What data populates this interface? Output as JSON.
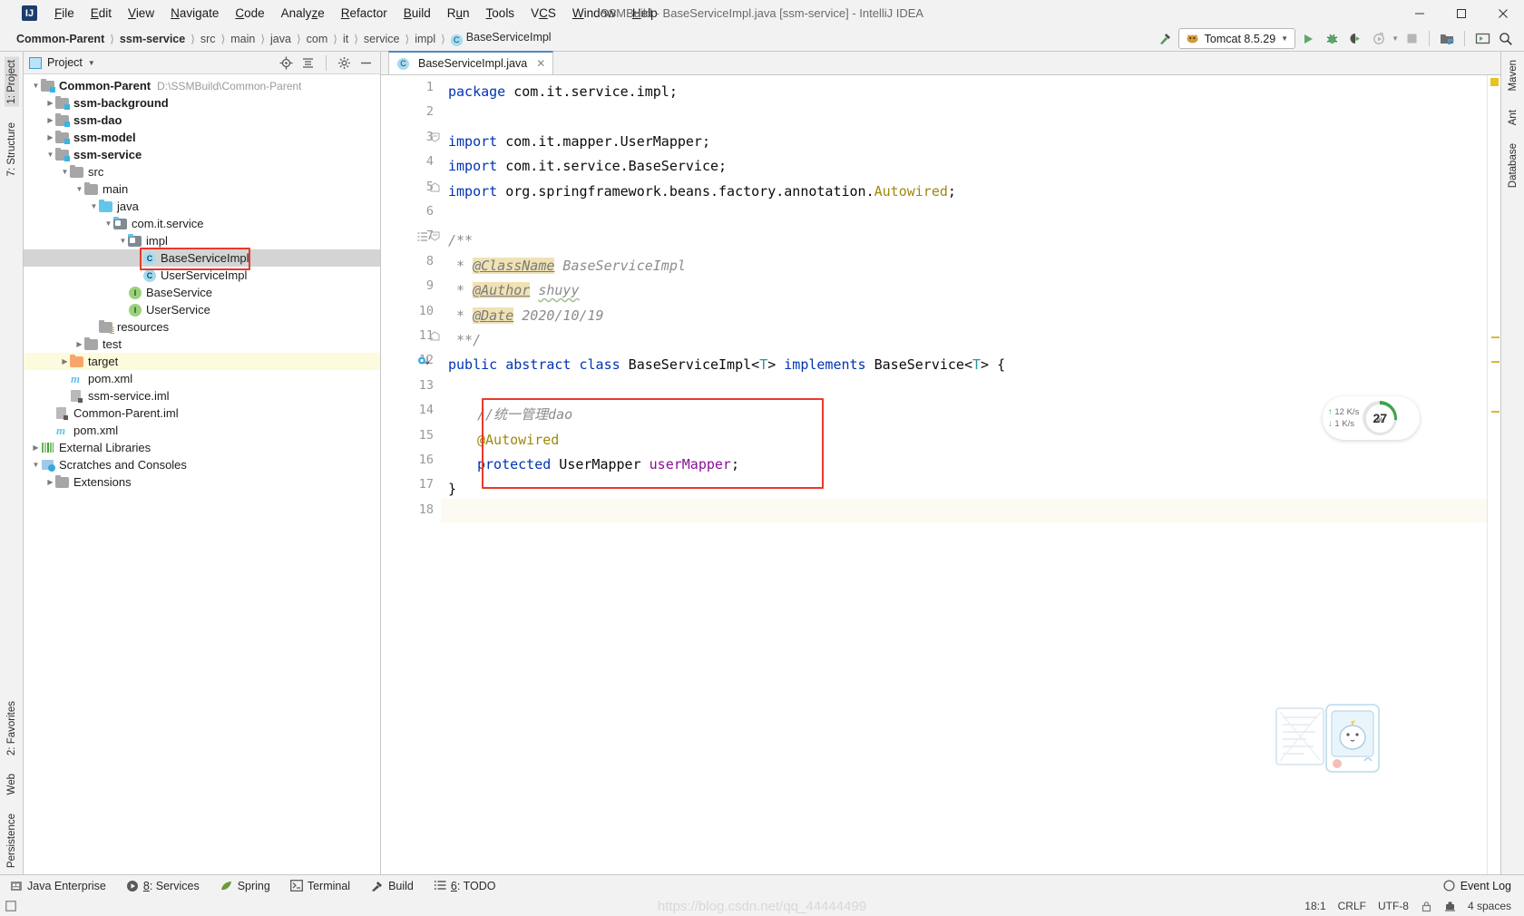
{
  "window": {
    "title": "SSMBuild - BaseServiceImpl.java [ssm-service] - IntelliJ IDEA",
    "logo": "IJ",
    "minimize": "–",
    "maximize": "☐",
    "close": "✕"
  },
  "menubar": [
    {
      "label": "File"
    },
    {
      "label": "Edit"
    },
    {
      "label": "View"
    },
    {
      "label": "Navigate"
    },
    {
      "label": "Code"
    },
    {
      "label": "Analyze"
    },
    {
      "label": "Refactor"
    },
    {
      "label": "Build"
    },
    {
      "label": "Run"
    },
    {
      "label": "Tools"
    },
    {
      "label": "VCS"
    },
    {
      "label": "Window"
    },
    {
      "label": "Help"
    }
  ],
  "breadcrumbs": [
    {
      "label": "Common-Parent",
      "bold": true
    },
    {
      "label": "ssm-service",
      "bold": true
    },
    {
      "label": "src"
    },
    {
      "label": "main"
    },
    {
      "label": "java"
    },
    {
      "label": "com"
    },
    {
      "label": "it"
    },
    {
      "label": "service"
    },
    {
      "label": "impl"
    },
    {
      "label": "BaseServiceImpl",
      "badge": "C"
    }
  ],
  "toolbar": {
    "run_config": "Tomcat 8.5.29",
    "run_button": "run-icon",
    "debug_button": "debug-icon",
    "coverage_button": "run-with-coverage-icon",
    "profiler_button": "profiler-icon",
    "stop_button": "stop-icon",
    "build_button": "make-project-icon",
    "update_button": "update-project-icon",
    "search_button": "search-everywhere-icon",
    "hammer_icon": "build-hammer-icon"
  },
  "left_rail": {
    "top": [
      {
        "label": "1: Project",
        "selected": true
      },
      {
        "label": "7: Structure",
        "selected": false
      }
    ],
    "bottom": [
      {
        "label": "2: Favorites"
      },
      {
        "label": "Web"
      },
      {
        "label": "Persistence"
      }
    ]
  },
  "right_rail": [
    {
      "label": "Maven"
    },
    {
      "label": "Ant"
    },
    {
      "label": "Database"
    }
  ],
  "project_panel": {
    "title": "Project",
    "actions": [
      "locate-icon",
      "collapse-all-icon",
      "settings-gear-icon",
      "hide-icon"
    ],
    "tree": [
      {
        "indent": 0,
        "arrow": "down",
        "icon": "module",
        "label": "Common-Parent",
        "bold": true,
        "path": "D:\\SSMBuild\\Common-Parent"
      },
      {
        "indent": 1,
        "arrow": "right",
        "icon": "module",
        "label": "ssm-background",
        "bold": true
      },
      {
        "indent": 1,
        "arrow": "right",
        "icon": "module",
        "label": "ssm-dao",
        "bold": true
      },
      {
        "indent": 1,
        "arrow": "right",
        "icon": "module",
        "label": "ssm-model",
        "bold": true
      },
      {
        "indent": 1,
        "arrow": "down",
        "icon": "module",
        "label": "ssm-service",
        "bold": true
      },
      {
        "indent": 2,
        "arrow": "down",
        "icon": "folder",
        "label": "src"
      },
      {
        "indent": 3,
        "arrow": "down",
        "icon": "folder",
        "label": "main"
      },
      {
        "indent": 4,
        "arrow": "down",
        "icon": "folder-blue",
        "label": "java"
      },
      {
        "indent": 5,
        "arrow": "down",
        "icon": "package",
        "label": "com.it.service"
      },
      {
        "indent": 6,
        "arrow": "down",
        "icon": "package",
        "label": "impl"
      },
      {
        "indent": 7,
        "arrow": "blank",
        "icon": "class",
        "label": "BaseServiceImpl",
        "selected": true,
        "boxed": true
      },
      {
        "indent": 7,
        "arrow": "blank",
        "icon": "class",
        "label": "UserServiceImpl"
      },
      {
        "indent": 6,
        "arrow": "blank",
        "icon": "interface",
        "label": "BaseService"
      },
      {
        "indent": 6,
        "arrow": "blank",
        "icon": "interface",
        "label": "UserService"
      },
      {
        "indent": 4,
        "arrow": "blank",
        "icon": "resources",
        "label": "resources"
      },
      {
        "indent": 3,
        "arrow": "right",
        "icon": "folder",
        "label": "test"
      },
      {
        "indent": 2,
        "arrow": "right",
        "icon": "folder-orange",
        "label": "target",
        "highlight": true
      },
      {
        "indent": 2,
        "arrow": "blank",
        "icon": "maven",
        "label": "pom.xml"
      },
      {
        "indent": 2,
        "arrow": "blank",
        "icon": "iml",
        "label": "ssm-service.iml"
      },
      {
        "indent": 1,
        "arrow": "blank",
        "icon": "iml",
        "label": "Common-Parent.iml"
      },
      {
        "indent": 1,
        "arrow": "blank",
        "icon": "maven",
        "label": "pom.xml"
      },
      {
        "indent": 0,
        "arrow": "right",
        "icon": "library",
        "label": "External Libraries"
      },
      {
        "indent": 0,
        "arrow": "down",
        "icon": "scratch",
        "label": "Scratches and Consoles"
      },
      {
        "indent": 1,
        "arrow": "right",
        "icon": "folder",
        "label": "Extensions"
      }
    ]
  },
  "editor": {
    "tab": {
      "label": "BaseServiceImpl.java",
      "badge": "C",
      "close": "✕"
    },
    "lines": [
      {
        "n": 1,
        "segments": [
          {
            "t": "package",
            "c": "kw"
          },
          {
            "t": " com.it.service.impl;",
            "c": "pl"
          }
        ]
      },
      {
        "n": 2,
        "segments": []
      },
      {
        "n": 3,
        "fold": "start",
        "segments": [
          {
            "t": "import",
            "c": "kw"
          },
          {
            "t": " com.it.mapper.UserMapper;",
            "c": "pl"
          }
        ]
      },
      {
        "n": 4,
        "segments": [
          {
            "t": "import",
            "c": "kw"
          },
          {
            "t": " com.it.service.BaseService;",
            "c": "pl"
          }
        ]
      },
      {
        "n": 5,
        "fold": "end",
        "segments": [
          {
            "t": "import",
            "c": "kw"
          },
          {
            "t": " org.springframework.beans.factory.annotation.",
            "c": "pl"
          },
          {
            "t": "Autowired",
            "c": "ann"
          },
          {
            "t": ";",
            "c": "pl"
          }
        ]
      },
      {
        "n": 6,
        "segments": []
      },
      {
        "n": 7,
        "fold": "start",
        "struct": true,
        "segments": [
          {
            "t": "/**",
            "c": "cmt"
          }
        ]
      },
      {
        "n": 8,
        "segments": [
          {
            "t": " * ",
            "c": "cmt"
          },
          {
            "t": "@ClassName",
            "c": "cmt-hl"
          },
          {
            "t": " BaseServiceImpl",
            "c": "cmt"
          }
        ]
      },
      {
        "n": 9,
        "segments": [
          {
            "t": " * ",
            "c": "cmt"
          },
          {
            "t": "@Author",
            "c": "cmt-hl"
          },
          {
            "t": " ",
            "c": "cmt"
          },
          {
            "t": "shuyy",
            "c": "cmt-sq"
          }
        ]
      },
      {
        "n": 10,
        "segments": [
          {
            "t": " * ",
            "c": "cmt"
          },
          {
            "t": "@Date",
            "c": "cmt-hl"
          },
          {
            "t": " 2020/10/19",
            "c": "cmt"
          }
        ]
      },
      {
        "n": 11,
        "fold": "end",
        "segments": [
          {
            "t": " **/",
            "c": "cmt"
          }
        ]
      },
      {
        "n": 12,
        "bulb": true,
        "segments": [
          {
            "t": "public",
            "c": "kw"
          },
          {
            "t": " ",
            "c": "pl"
          },
          {
            "t": "abstract",
            "c": "kw"
          },
          {
            "t": " ",
            "c": "pl"
          },
          {
            "t": "class",
            "c": "kw"
          },
          {
            "t": " BaseServiceImpl<",
            "c": "pl"
          },
          {
            "t": "T",
            "c": "tparam"
          },
          {
            "t": "> ",
            "c": "pl"
          },
          {
            "t": "implements",
            "c": "kw"
          },
          {
            "t": " BaseService<",
            "c": "pl"
          },
          {
            "t": "T",
            "c": "tparam"
          },
          {
            "t": "> {",
            "c": "pl"
          }
        ]
      },
      {
        "n": 13,
        "segments": []
      },
      {
        "n": 14,
        "indent": 1,
        "segments": [
          {
            "t": "//统一管理dao",
            "c": "cmt"
          }
        ]
      },
      {
        "n": 15,
        "indent": 1,
        "segments": [
          {
            "t": "@Autowired",
            "c": "ann"
          }
        ]
      },
      {
        "n": 16,
        "indent": 1,
        "segments": [
          {
            "t": "protected",
            "c": "kw"
          },
          {
            "t": " UserMapper ",
            "c": "pl"
          },
          {
            "t": "userMapper",
            "c": "fld"
          },
          {
            "t": ";",
            "c": "pl"
          }
        ]
      },
      {
        "n": 17,
        "segments": [
          {
            "t": "}",
            "c": "pl"
          }
        ]
      },
      {
        "n": 18,
        "caret": true,
        "segments": []
      }
    ]
  },
  "network_widget": {
    "upload": "12 K/s",
    "download": "1  K/s",
    "upload_arrow": "↑",
    "download_arrow": "↓",
    "cpu_percent": "27",
    "cpu_unit": "%"
  },
  "bottom_bar": {
    "tools": [
      {
        "label": "Java Enterprise",
        "icon": "java-enterprise-icon"
      },
      {
        "label": "8: Services",
        "icon": "services-icon",
        "mnemonic": "8"
      },
      {
        "label": "Spring",
        "icon": "spring-leaf-icon"
      },
      {
        "label": "Terminal",
        "icon": "terminal-icon"
      },
      {
        "label": "Build",
        "icon": "build-hammer-icon"
      },
      {
        "label": "6: TODO",
        "icon": "todo-list-icon",
        "mnemonic": "6"
      }
    ],
    "event_log": "Event Log"
  },
  "status_bar": {
    "position": "18:1",
    "line_sep": "CRLF",
    "encoding": "UTF-8",
    "lock_icon": "read-only-lock-icon",
    "git_icon": "git-branch-icon",
    "indent": "4 spaces",
    "watermark": "https://blog.csdn.net/qq_44444499"
  },
  "colors": {
    "accent": "#4a88c7",
    "keyword": "#0033b3",
    "annotation": "#9e880d",
    "field": "#871094",
    "comment": "#8c8c8c",
    "highlight_box": "#e8392b",
    "selection": "#d4d4d4",
    "target_highlight": "#fcfbdd"
  }
}
